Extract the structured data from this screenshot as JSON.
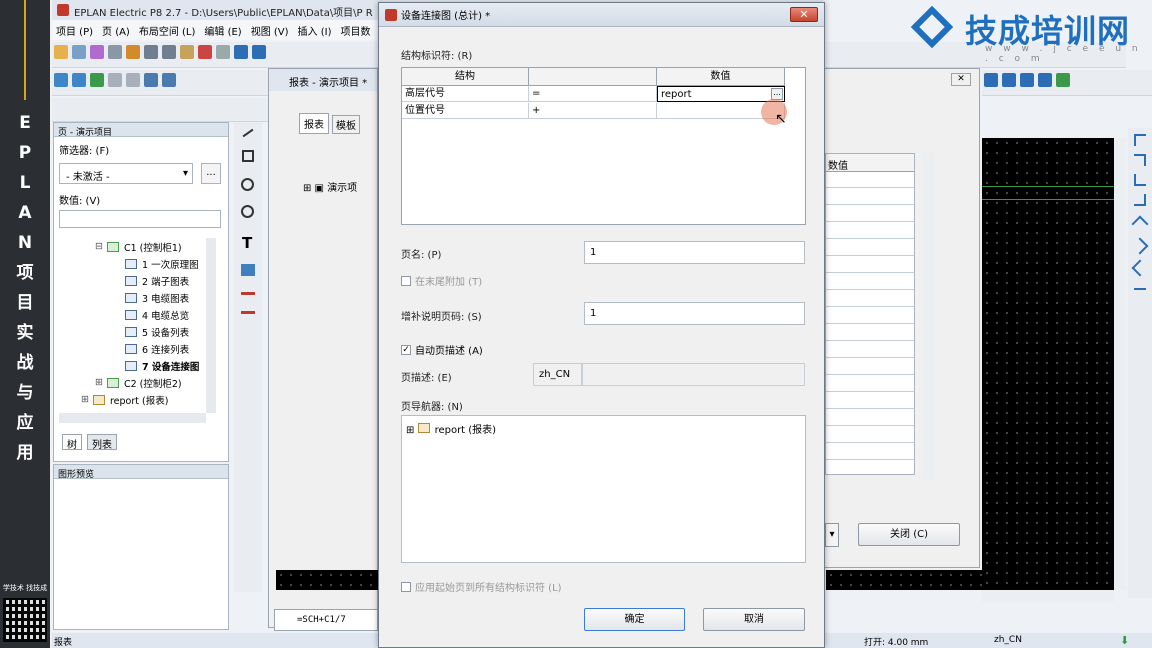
{
  "banner": {
    "vertical_text": "EPLAN项目实战与应用",
    "footer": "学技术 找技成"
  },
  "watermark": {
    "text": "技成培训网",
    "url": "w w w . j c e e u n . c o m"
  },
  "app": {
    "title": "EPLAN Electric P8 2.7 - D:\\Users\\Public\\EPLAN\\Data\\项目\\P R C",
    "menu": [
      "项目 (P)",
      "页 (A)",
      "布局空间 (L)",
      "编辑 (E)",
      "视图 (V)",
      "插入 (I)",
      "项目数"
    ]
  },
  "left_pane": {
    "header": "页 - 演示项目",
    "filter_label": "筛选器: (F)",
    "filter_value": "- 未激活 -",
    "filter_btn": "...",
    "value_label": "数值: (V)",
    "tree": [
      {
        "label": "C1 (控制柜1)",
        "level": 1
      },
      {
        "label": "1 一次原理图",
        "level": 2
      },
      {
        "label": "2 端子图表",
        "level": 2
      },
      {
        "label": "3 电缆图表",
        "level": 2
      },
      {
        "label": "4 电缆总览",
        "level": 2
      },
      {
        "label": "5 设备列表",
        "level": 2
      },
      {
        "label": "6 连接列表",
        "level": 2
      },
      {
        "label": "7 设备连接图",
        "level": 2
      },
      {
        "label": "C2 (控制柜2)",
        "level": 1
      },
      {
        "label": "report (报表)",
        "level": 0
      }
    ],
    "tabs": [
      "树",
      "列表"
    ],
    "preview_header": "图形预览"
  },
  "report_window": {
    "title": "报表 - 演示项目 *",
    "tabs": [
      "报表",
      "模板"
    ],
    "tree_item": "演示项",
    "bottom_tab": "=SCH+C1/7"
  },
  "right_window": {
    "col_header": "数值",
    "close_btn": "关闭 (C)"
  },
  "status": {
    "left": "报表",
    "open": "打开: 4.00 mm",
    "lang": "zh_CN"
  },
  "dialog": {
    "title": "设备连接图 (总计) *",
    "close": "✕",
    "struct_label": "结构标识符: (R)",
    "grid_headers": [
      "结构",
      "",
      "数值"
    ],
    "grid_rows": [
      {
        "name": "高层代号",
        "op": "=",
        "value": "report",
        "btn": "..."
      },
      {
        "name": "位置代号",
        "op": "+",
        "value": "",
        "btn": ""
      }
    ],
    "page_name_label": "页名: (P)",
    "page_name": "1",
    "append_label": "在末尾附加 (T)",
    "supp_label": "增补说明页码: (S)",
    "supp_value": "1",
    "auto_desc_label": "自动页描述 (A)",
    "page_desc_label": "页描述: (E)",
    "page_desc_lang": "zh_CN",
    "page_desc_value": "",
    "nav_label": "页导航器: (N)",
    "nav_item": "report (报表)",
    "apply_all_label": "应用起始页到所有结构标识符 (L)",
    "ok": "确定",
    "cancel": "取消"
  }
}
